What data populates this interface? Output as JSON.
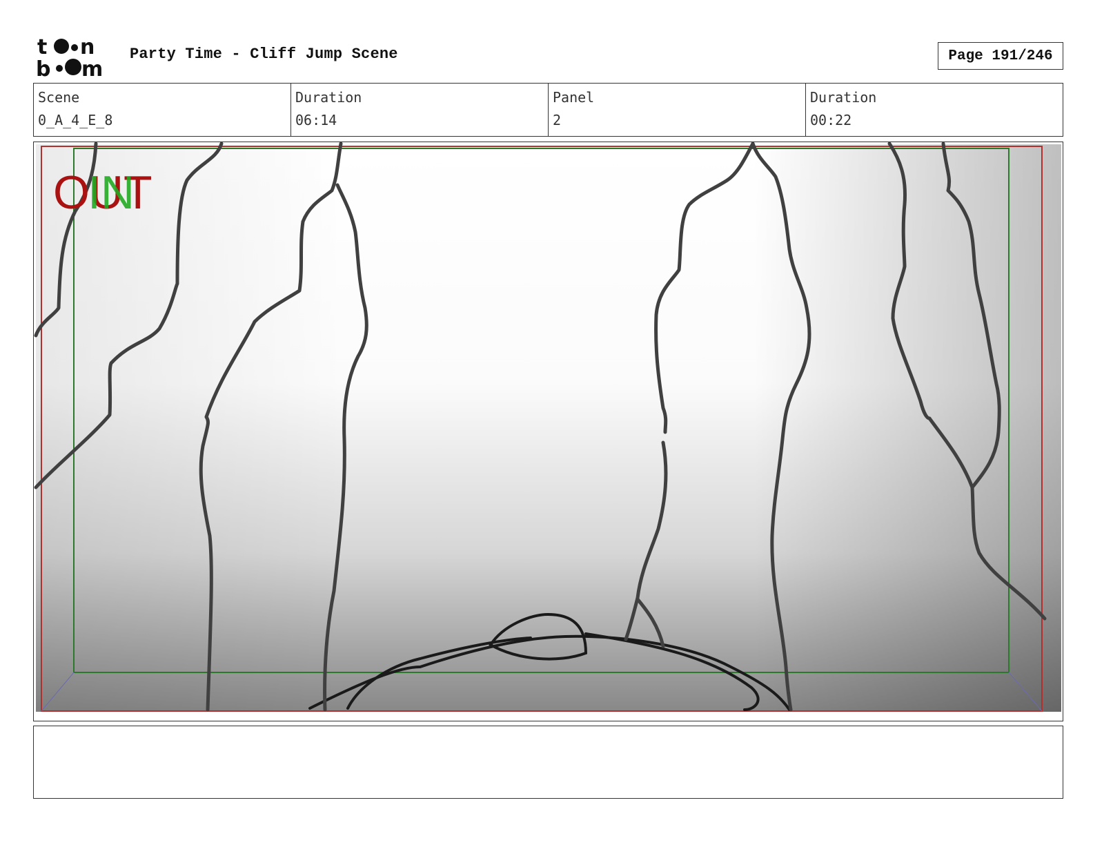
{
  "header": {
    "logo_text": "toon boom",
    "title": "Party Time - Cliff Jump Scene",
    "page": "Page 191/246"
  },
  "info": {
    "scene_label": "Scene",
    "scene_value": "0_A_4_E_8",
    "scene_duration_label": "Duration",
    "scene_duration_value": "06:14",
    "panel_label": "Panel",
    "panel_value": "2",
    "panel_duration_label": "Duration",
    "panel_duration_value": "00:22"
  },
  "panel": {
    "in_marker": "IN",
    "out_marker": "OUT",
    "colors": {
      "in": "#22aa22",
      "out": "#aa1111",
      "field_frame_outer": "#b03030",
      "field_frame_inner": "#2a7a2a",
      "sketch": "#404040"
    }
  },
  "notes": {
    "text": ""
  }
}
